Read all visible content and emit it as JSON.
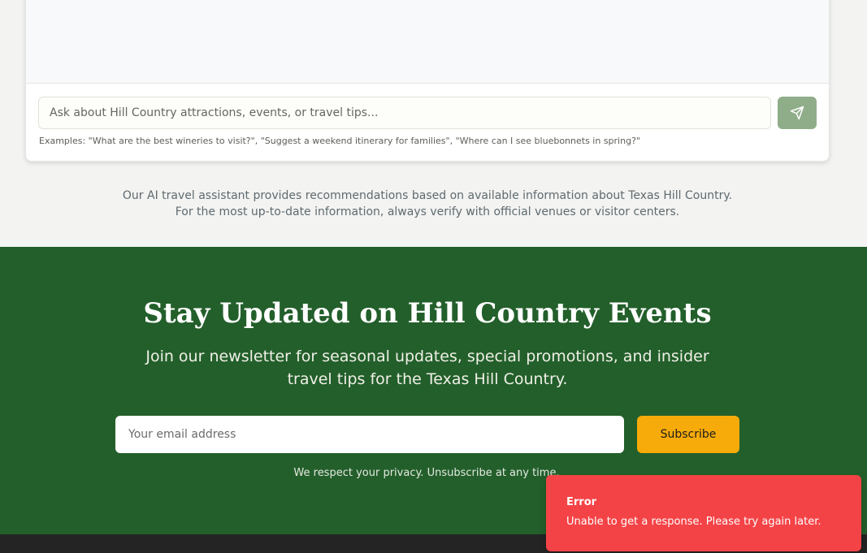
{
  "chat": {
    "input_placeholder": "Ask about Hill Country attractions, events, or travel tips...",
    "send_icon": "send-icon",
    "examples": "Examples: \"What are the best wineries to visit?\", \"Suggest a weekend itinerary for families\", \"Where can I see bluebonnets in spring?\""
  },
  "disclaimer": {
    "line1": "Our AI travel assistant provides recommendations based on available information about Texas Hill Country.",
    "line2": "For the most up-to-date information, always verify with official venues or visitor centers."
  },
  "newsletter": {
    "title": "Stay Updated on Hill Country Events",
    "description": "Join our newsletter for seasonal updates, special promotions, and insider travel tips for the Texas Hill Country.",
    "email_placeholder": "Your email address",
    "subscribe_label": "Subscribe",
    "privacy_note": "We respect your privacy. Unsubscribe at any time."
  },
  "toast": {
    "title": "Error",
    "message": "Unable to get a response. Please try again later."
  },
  "colors": {
    "newsletter_bg": "#235f2b",
    "subscribe_button": "#f7ab0a",
    "send_button": "#90ad8a",
    "toast_bg": "#f44346",
    "footer_bg": "#242424"
  }
}
